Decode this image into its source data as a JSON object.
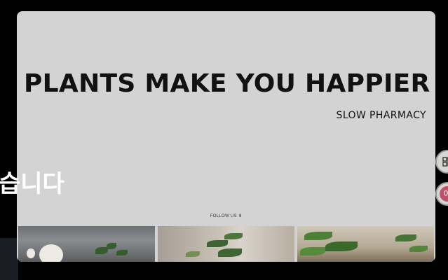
{
  "hero": {
    "headline": "PLANTS MAKE YOU HAPPIER",
    "brand": "SLOW PHARMACY",
    "follow": "FOLLOW US ⬇"
  },
  "overlay": {
    "text": "습니다"
  },
  "side_buttons": {
    "avatar_initial": "아"
  },
  "colors": {
    "page_bg": "#000000",
    "card_bg": "#d3d3d3",
    "headline": "#111111",
    "avatar": "#c0506a"
  },
  "icons": {
    "first_side_button": "grid-icon",
    "second_side_button": "avatar"
  }
}
